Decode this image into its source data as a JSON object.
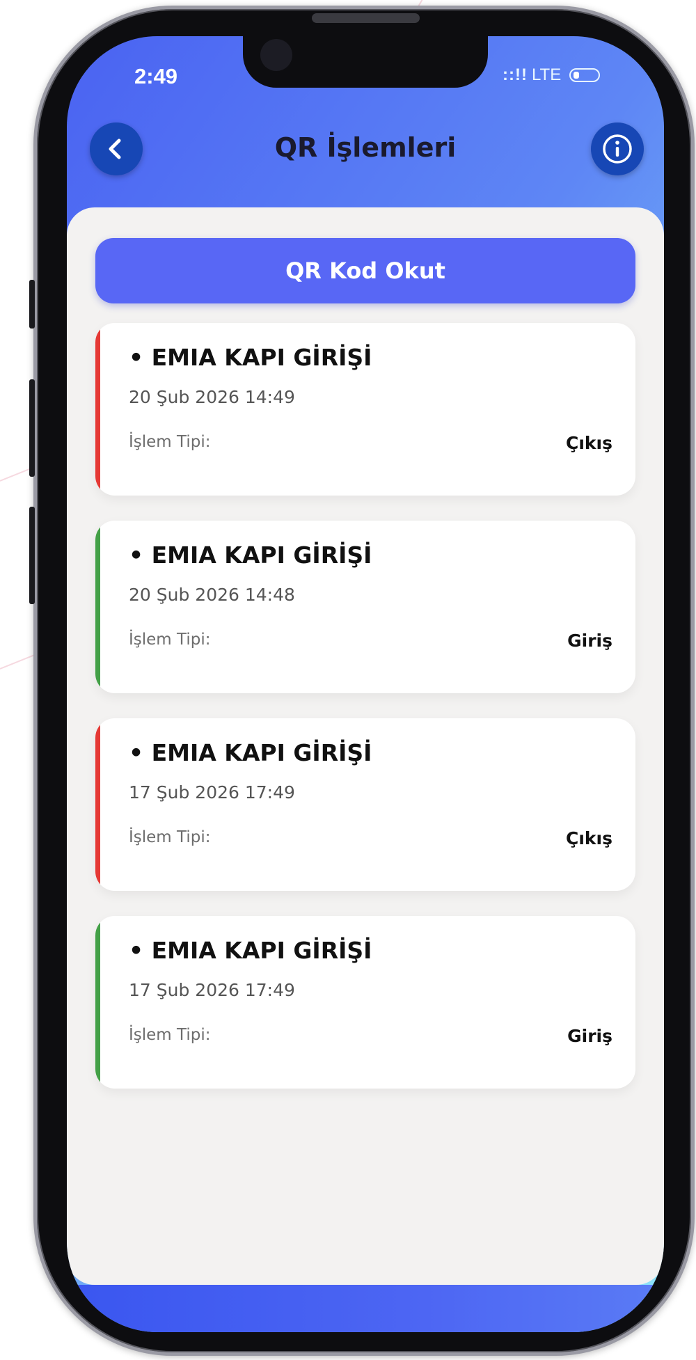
{
  "status_bar": {
    "time": "2:49",
    "signal": "::!!",
    "network": "LTE"
  },
  "header": {
    "title": "QR İşlemleri",
    "back_icon": "chevron-left-icon",
    "info_icon": "info-icon"
  },
  "actions": {
    "scan_label": "QR Kod Okut"
  },
  "colors": {
    "exit": "#e53935",
    "entry": "#43a047",
    "primary": "#5867f5",
    "header_button": "#1747b5"
  },
  "transactions": [
    {
      "title": "• EMIA KAPI GİRİŞİ",
      "date": "20 Şub 2026 14:49",
      "type_label": "İşlem Tipi:",
      "type_value": "Çıkış",
      "status": "exit"
    },
    {
      "title": "• EMIA KAPI GİRİŞİ",
      "date": "20 Şub 2026 14:48",
      "type_label": "İşlem Tipi:",
      "type_value": "Giriş",
      "status": "entry"
    },
    {
      "title": "• EMIA KAPI GİRİŞİ",
      "date": "17 Şub 2026 17:49",
      "type_label": "İşlem Tipi:",
      "type_value": "Çıkış",
      "status": "exit"
    },
    {
      "title": "• EMIA KAPI GİRİŞİ",
      "date": "17 Şub 2026 17:49",
      "type_label": "İşlem Tipi:",
      "type_value": "Giriş",
      "status": "entry"
    }
  ]
}
